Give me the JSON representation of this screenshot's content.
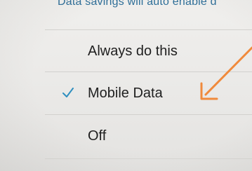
{
  "header": {
    "hint_text": "Data savings will auto enable d"
  },
  "options": [
    {
      "label": "Always do this",
      "selected": false
    },
    {
      "label": "Mobile Data",
      "selected": true
    },
    {
      "label": "Off",
      "selected": false
    }
  ],
  "colors": {
    "accent": "#2f8fbf",
    "arrow": "#f08a3c",
    "text": "#1f1f1f"
  },
  "icons": {
    "check": "checkmark-icon",
    "annotation": "arrow-annotation"
  }
}
